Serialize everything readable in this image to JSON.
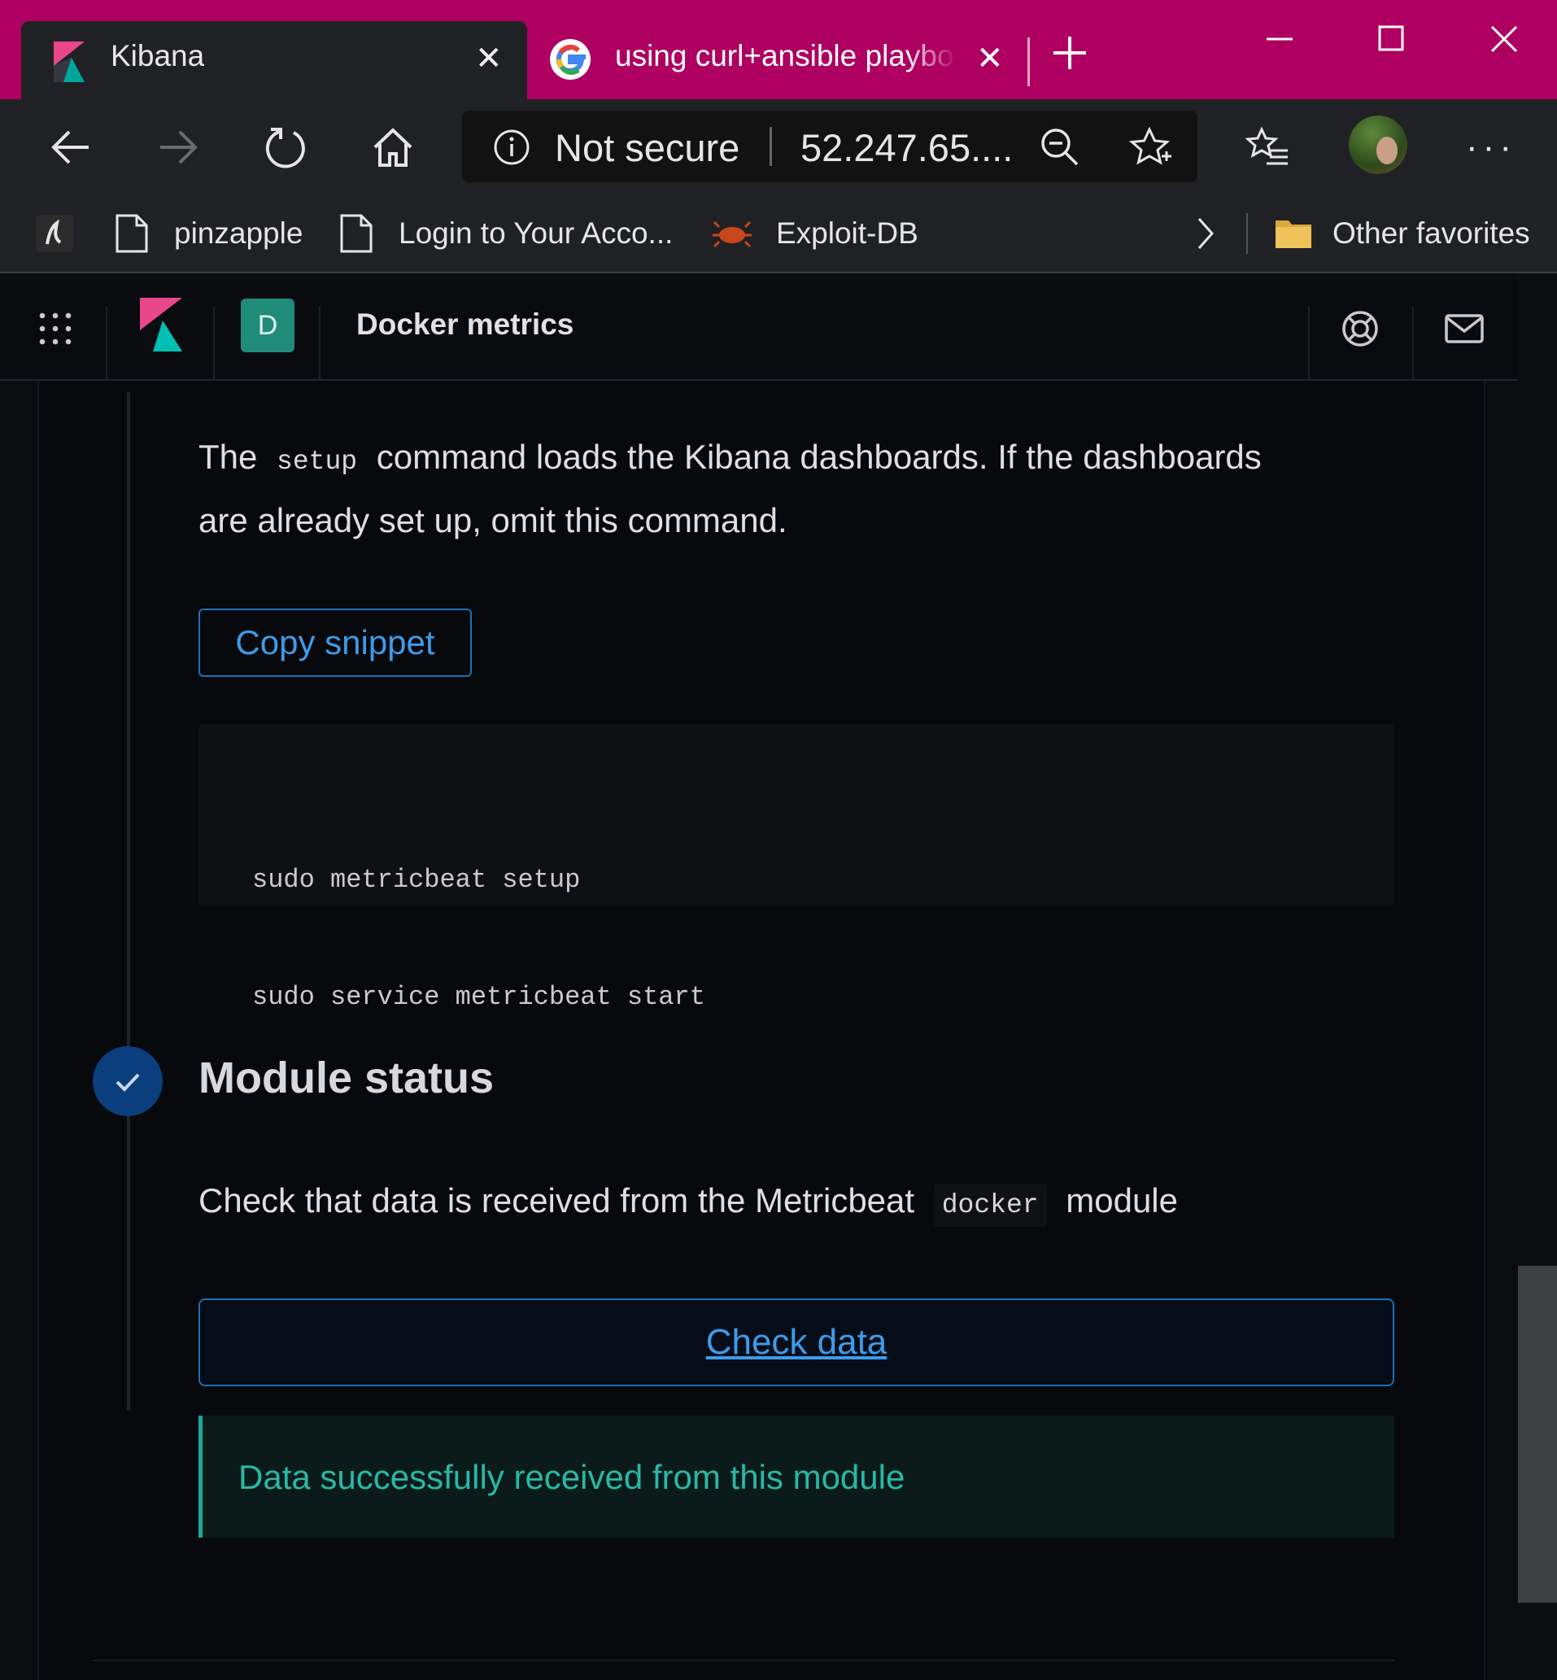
{
  "browser": {
    "tabs": [
      {
        "title": "Kibana",
        "active": true
      },
      {
        "title": "using curl+ansible playbook",
        "active": false
      }
    ],
    "address": {
      "security": "Not secure",
      "url": "52.247.65...."
    },
    "favorites": [
      {
        "label": "pinzapple"
      },
      {
        "label": "Login to Your Acco..."
      },
      {
        "label": "Exploit-DB"
      }
    ],
    "other_favorites": "Other favorites",
    "colors": {
      "titlebar": "#ae0060",
      "chrome": "#202124"
    }
  },
  "kibana": {
    "space_avatar": "D",
    "breadcrumb": "Docker metrics"
  },
  "step_setup": {
    "text_before": "The",
    "code": "setup",
    "text_after": "command loads the Kibana dashboards. If the dashboards",
    "text_line2": "are already set up, omit this command.",
    "copy_button": "Copy snippet",
    "snippet": [
      "sudo metricbeat setup",
      "sudo service metricbeat start"
    ]
  },
  "step_status": {
    "title": "Module status",
    "desc_before": "Check that data is received from the Metricbeat",
    "code": "docker",
    "desc_after": "module",
    "check_button": "Check data",
    "callout": "Data successfully received from this module"
  }
}
